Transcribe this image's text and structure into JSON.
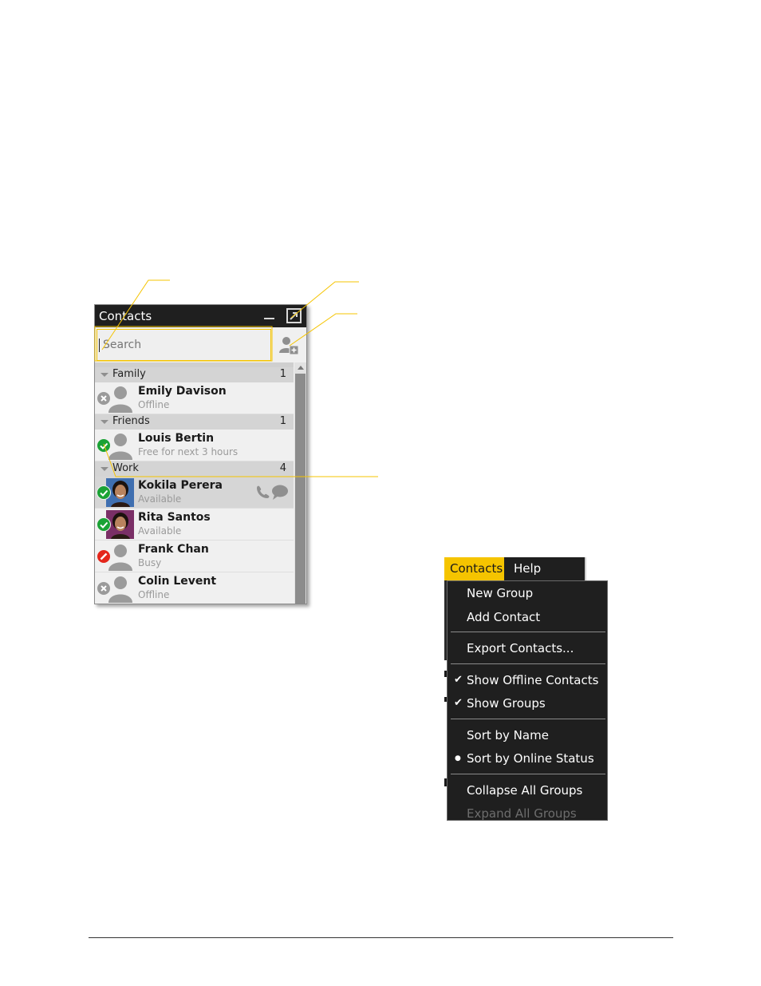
{
  "contacts_window": {
    "title": "Contacts",
    "search": {
      "value": "",
      "placeholder": "Search"
    },
    "groups": [
      {
        "name": "Family",
        "count": "1",
        "contacts": [
          {
            "name": "Emily Davison",
            "status_text": "Offline",
            "presence": "offline",
            "photo": "silhouette"
          }
        ]
      },
      {
        "name": "Friends",
        "count": "1",
        "contacts": [
          {
            "name": "Louis Bertin",
            "status_text": "Free for next 3 hours",
            "presence": "available",
            "photo": "silhouette"
          }
        ]
      },
      {
        "name": "Work",
        "count": "4",
        "contacts": [
          {
            "name": "Kokila Perera",
            "status_text": "Available",
            "presence": "available",
            "photo": "portrait-blue",
            "selected": true
          },
          {
            "name": "Rita Santos",
            "status_text": "Available",
            "presence": "available",
            "photo": "portrait-purple"
          },
          {
            "name": "Frank Chan",
            "status_text": "Busy",
            "presence": "busy",
            "photo": "silhouette"
          },
          {
            "name": "Colin Levent",
            "status_text": "Offline",
            "presence": "offline",
            "photo": "silhouette"
          }
        ]
      }
    ],
    "icons": {
      "minimize": "minimize-icon",
      "popout": "popout-icon",
      "add_contact": "add-contact-icon",
      "call": "phone-icon",
      "chat": "chat-bubble-icon"
    },
    "presence_colors": {
      "available": "#1aa235",
      "busy": "#e4261b",
      "offline": "#9a9a9a"
    }
  },
  "menu": {
    "bar": [
      {
        "label": "Contacts",
        "active": true
      },
      {
        "label": "Help",
        "active": false
      }
    ],
    "items": [
      {
        "label": "New Group",
        "mark": ""
      },
      {
        "label": "Add Contact",
        "mark": ""
      },
      {
        "separator": true
      },
      {
        "label": "Export Contacts...",
        "mark": ""
      },
      {
        "separator": true
      },
      {
        "label": "Show Offline Contacts",
        "mark": "check"
      },
      {
        "label": "Show Groups",
        "mark": "check"
      },
      {
        "separator": true
      },
      {
        "label": "Sort by Name",
        "mark": ""
      },
      {
        "label": "Sort by Online Status",
        "mark": "bullet"
      },
      {
        "separator": true
      },
      {
        "label": "Collapse All Groups",
        "mark": ""
      },
      {
        "label": "Expand All Groups",
        "mark": "",
        "disabled": true
      }
    ]
  },
  "colors": {
    "accent": "#f5c400",
    "window_dark": "#1f1f1f"
  }
}
